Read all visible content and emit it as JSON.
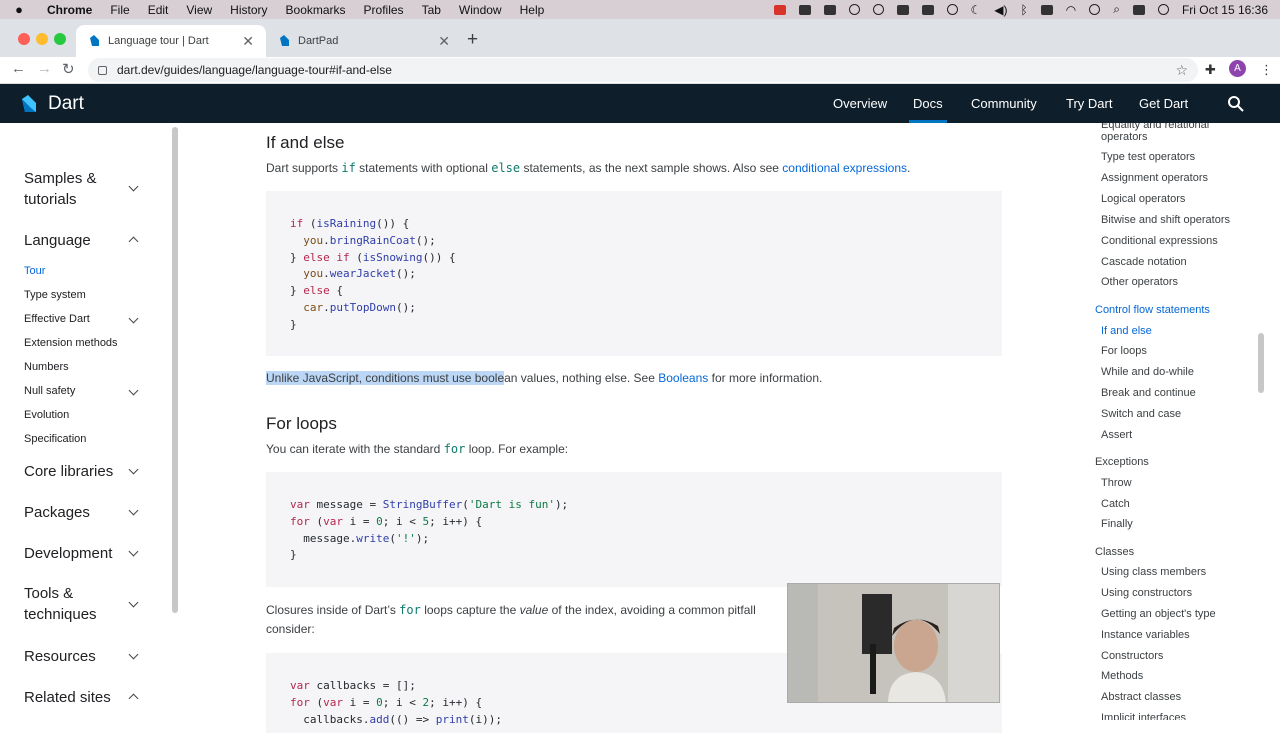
{
  "menubar": {
    "app": "Chrome",
    "items": [
      "File",
      "Edit",
      "View",
      "History",
      "Bookmarks",
      "Profiles",
      "Tab",
      "Window",
      "Help"
    ],
    "clock": "Fri Oct 15  16:36"
  },
  "browser": {
    "tabs": [
      {
        "title": "Language tour | Dart",
        "close": "✕"
      },
      {
        "title": "DartPad",
        "close": "✕"
      }
    ],
    "new_tab": "+",
    "url": "dart.dev/guides/language/language-tour#if-and-else",
    "avatar_letter": "A"
  },
  "site_header": {
    "brand": "Dart",
    "nav": [
      "Overview",
      "Docs",
      "Community",
      "Try Dart",
      "Get Dart"
    ],
    "accent_color": "#0175c2",
    "bg_color": "#0e1e2a"
  },
  "left_nav": {
    "samples": "Samples &\ntutorials",
    "language": "Language",
    "language_items": [
      "Tour",
      "Type system",
      "Effective Dart",
      "Extension methods",
      "Numbers",
      "Null safety",
      "Evolution",
      "Specification"
    ],
    "core_libraries": "Core libraries",
    "packages": "Packages",
    "development": "Development",
    "tools": "Tools &\ntechniques",
    "resources": "Resources",
    "related_sites": "Related sites"
  },
  "content": {
    "h_if_else": "If and else",
    "p_if_1": "Dart supports ",
    "p_if_code1": "if",
    "p_if_2": " statements with optional ",
    "p_if_code2": "else",
    "p_if_3": " statements, as the next sample shows. Also see ",
    "p_if_link": "conditional expressions",
    "p_if_4": ".",
    "code_if": [
      "if (isRaining()) {",
      "  you.bringRainCoat();",
      "} else if (isSnowing()) {",
      "  you.wearJacket();",
      "} else {",
      "  car.putTopDown();",
      "}"
    ],
    "p_bool_hl": "Unlike JavaScript, conditions must use boole",
    "p_bool_rest": "an values, nothing else. See ",
    "p_bool_link": "Booleans",
    "p_bool_end": " for more information.",
    "h_for": "For loops",
    "p_for_1": "You can iterate with the standard ",
    "p_for_code": "for",
    "p_for_2": " loop. For example:",
    "code_for": [
      "var message = StringBuffer('Dart is fun');",
      "for (var i = 0; i < 5; i++) {",
      "  message.write('!');",
      "}"
    ],
    "p_clos_1": "Closures inside of Dart’s ",
    "p_clos_code": "for",
    "p_clos_2": " loops capture the ",
    "p_clos_em": "value",
    "p_clos_3": " of the index, avoiding a common pitfall",
    "p_clos_4": "consider:",
    "code_cb": [
      "var callbacks = [];",
      "for (var i = 0; i < 2; i++) {",
      "  callbacks.add(() => print(i));"
    ]
  },
  "toc": {
    "items": [
      {
        "text": "Equality and relational",
        "level": "sub"
      },
      {
        "text": "operators",
        "level": "sub"
      },
      {
        "text": "Type test operators",
        "level": "sub"
      },
      {
        "text": "Assignment operators",
        "level": "sub"
      },
      {
        "text": "Logical operators",
        "level": "sub"
      },
      {
        "text": "Bitwise and shift operators",
        "level": "sub"
      },
      {
        "text": "Conditional expressions",
        "level": "sub"
      },
      {
        "text": "Cascade notation",
        "level": "sub"
      },
      {
        "text": "Other operators",
        "level": "sub"
      },
      {
        "text": "Control flow statements",
        "level": "head",
        "active": true
      },
      {
        "text": "If and else",
        "level": "sub",
        "active": true
      },
      {
        "text": "For loops",
        "level": "sub"
      },
      {
        "text": "While and do-while",
        "level": "sub"
      },
      {
        "text": "Break and continue",
        "level": "sub"
      },
      {
        "text": "Switch and case",
        "level": "sub"
      },
      {
        "text": "Assert",
        "level": "sub"
      },
      {
        "text": "Exceptions",
        "level": "head"
      },
      {
        "text": "Throw",
        "level": "sub"
      },
      {
        "text": "Catch",
        "level": "sub"
      },
      {
        "text": "Finally",
        "level": "sub"
      },
      {
        "text": "Classes",
        "level": "head"
      },
      {
        "text": "Using class members",
        "level": "sub"
      },
      {
        "text": "Using constructors",
        "level": "sub"
      },
      {
        "text": "Getting an object's type",
        "level": "sub"
      },
      {
        "text": "Instance variables",
        "level": "sub"
      },
      {
        "text": "Constructors",
        "level": "sub"
      },
      {
        "text": "Methods",
        "level": "sub"
      },
      {
        "text": "Abstract classes",
        "level": "sub"
      },
      {
        "text": "Implicit interfaces",
        "level": "sub"
      }
    ]
  }
}
